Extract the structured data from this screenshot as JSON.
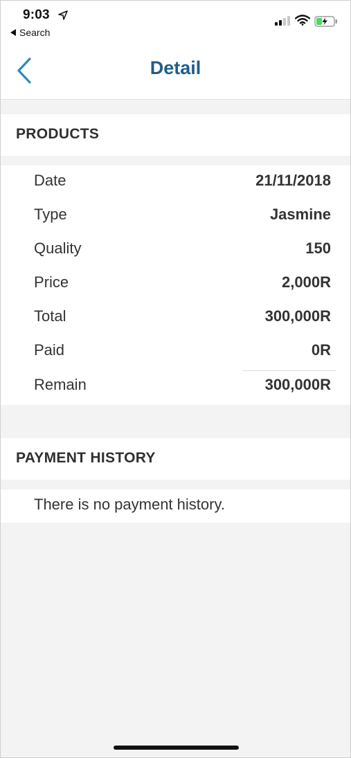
{
  "status_bar": {
    "time": "9:03",
    "back_app_label": "Search",
    "icons": [
      "location-arrow-icon",
      "cellular-signal-icon",
      "wifi-icon",
      "battery-charging-icon"
    ]
  },
  "nav": {
    "title": "Detail",
    "back_icon": "chevron-left-icon",
    "accent_color": "#1e5d8a"
  },
  "products": {
    "header": "PRODUCTS",
    "rows": [
      {
        "label": "Date",
        "value": "21/11/2018"
      },
      {
        "label": "Type",
        "value": "Jasmine"
      },
      {
        "label": "Quality",
        "value": "150"
      },
      {
        "label": "Price",
        "value": "2,000R"
      },
      {
        "label": "Total",
        "value": "300,000R"
      },
      {
        "label": "Paid",
        "value": "0R"
      },
      {
        "label": "Remain",
        "value": "300,000R"
      }
    ]
  },
  "payment_history": {
    "header": "PAYMENT HISTORY",
    "empty_message": "There is no payment history."
  },
  "colors": {
    "background": "#f3f3f3",
    "card": "#ffffff",
    "text": "#333333"
  }
}
